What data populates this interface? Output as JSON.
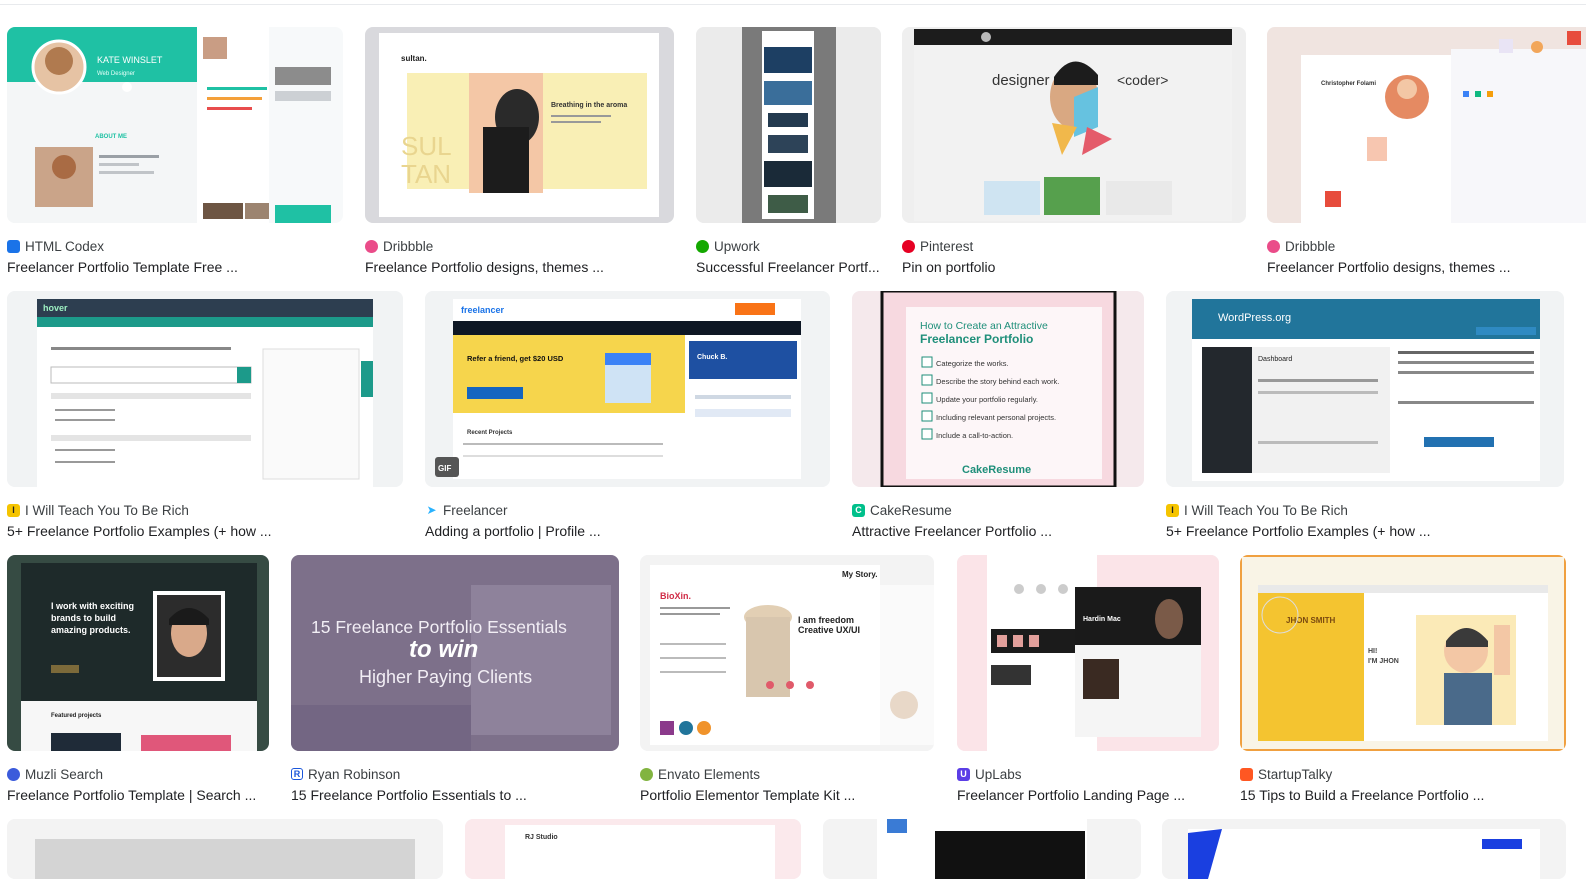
{
  "results": [
    {
      "source": "HTML Codex",
      "title": "Freelancer Portfolio Template Free ...",
      "favicon": "html-codex-icon",
      "favicon_color": "#1a73e8",
      "thumb_text": [
        "KATE WINSLET",
        "Web Designer",
        "ABOUT ME"
      ]
    },
    {
      "source": "Dribbble",
      "title": "Freelance Portfolio designs, themes ...",
      "favicon": "dribbble-icon",
      "favicon_color": "#ea4c89",
      "thumb_text": [
        "sultan.",
        "SUL",
        "TAN",
        "Breathing in the aroma"
      ]
    },
    {
      "source": "Upwork",
      "title": "Successful Freelancer Portf...",
      "favicon": "upwork-icon",
      "favicon_color": "#14a800",
      "thumb_text": []
    },
    {
      "source": "Pinterest",
      "title": "Pin on portfolio",
      "favicon": "pinterest-icon",
      "favicon_color": "#e60023",
      "thumb_text": [
        "designer",
        "<coder>"
      ]
    },
    {
      "source": "Dribbble",
      "title": "Freelancer Portfolio designs, themes ...",
      "favicon": "dribbble-icon",
      "favicon_color": "#ea4c89",
      "thumb_text": [
        "Christopher Folami"
      ]
    },
    {
      "source": "I Will Teach You To Be Rich",
      "title": "5+ Freelance Portfolio Examples (+ how ...",
      "favicon": "iwt-icon",
      "favicon_color": "#f5c400",
      "thumb_text": [
        "hover"
      ]
    },
    {
      "source": "Freelancer",
      "title": "Adding a portfolio | Profile ...",
      "favicon": "freelancer-icon",
      "favicon_color": "#29b2fe",
      "thumb_text": [
        "freelancer",
        "Refer a friend, get $20 USD",
        "Recent Projects",
        "Chuck B.",
        "GIF"
      ]
    },
    {
      "source": "CakeResume",
      "title": "Attractive Freelancer Portfolio ...",
      "favicon": "cakeresume-icon",
      "favicon_color": "#00c08b",
      "thumb_text": [
        "How to Create an Attractive",
        "Freelancer Portfolio",
        "Categorize the works.",
        "Describe the story behind each work.",
        "Update your portfolio regularly.",
        "Including relevant personal projects.",
        "Include a call-to-action.",
        "CakeResume"
      ]
    },
    {
      "source": "I Will Teach You To Be Rich",
      "title": "5+ Freelance Portfolio Examples (+ how ...",
      "favicon": "iwt-icon",
      "favicon_color": "#f5c400",
      "thumb_text": [
        "WordPress.org",
        "Dashboard"
      ]
    },
    {
      "source": "Muzli Search",
      "title": "Freelance Portfolio Template | Search ...",
      "favicon": "muzli-icon",
      "favicon_color": "#3b5bdb",
      "thumb_text": [
        "I work with exciting",
        "brands to build",
        "amazing products.",
        "Featured projects"
      ]
    },
    {
      "source": "Ryan Robinson",
      "title": "15 Freelance Portfolio Essentials to ...",
      "favicon": "ryan-robinson-icon",
      "favicon_color": "#1a56db",
      "thumb_text": [
        "15 Freelance Portfolio Essentials",
        "to win",
        "Higher Paying Clients"
      ]
    },
    {
      "source": "Envato Elements",
      "title": "Portfolio Elementor Template Kit ...",
      "favicon": "envato-icon",
      "favicon_color": "#82b440",
      "thumb_text": [
        "BioXin.",
        "I am freedom",
        "Creative UX/UI",
        "My Story."
      ]
    },
    {
      "source": "UpLabs",
      "title": "Freelancer Portfolio Landing Page ...",
      "favicon": "uplabs-icon",
      "favicon_color": "#5b3ee6",
      "thumb_text": [
        "Hardin Mac"
      ]
    },
    {
      "source": "StartupTalky",
      "title": "15 Tips to Build a Freelance Portfolio ...",
      "favicon": "startuptalky-icon",
      "favicon_color": "#ff5722",
      "thumb_text": [
        "JHON SMITH",
        "HI!",
        "I'M JHON"
      ]
    }
  ],
  "partial_row": {
    "thumb_text": [
      "RJ Studio"
    ]
  }
}
